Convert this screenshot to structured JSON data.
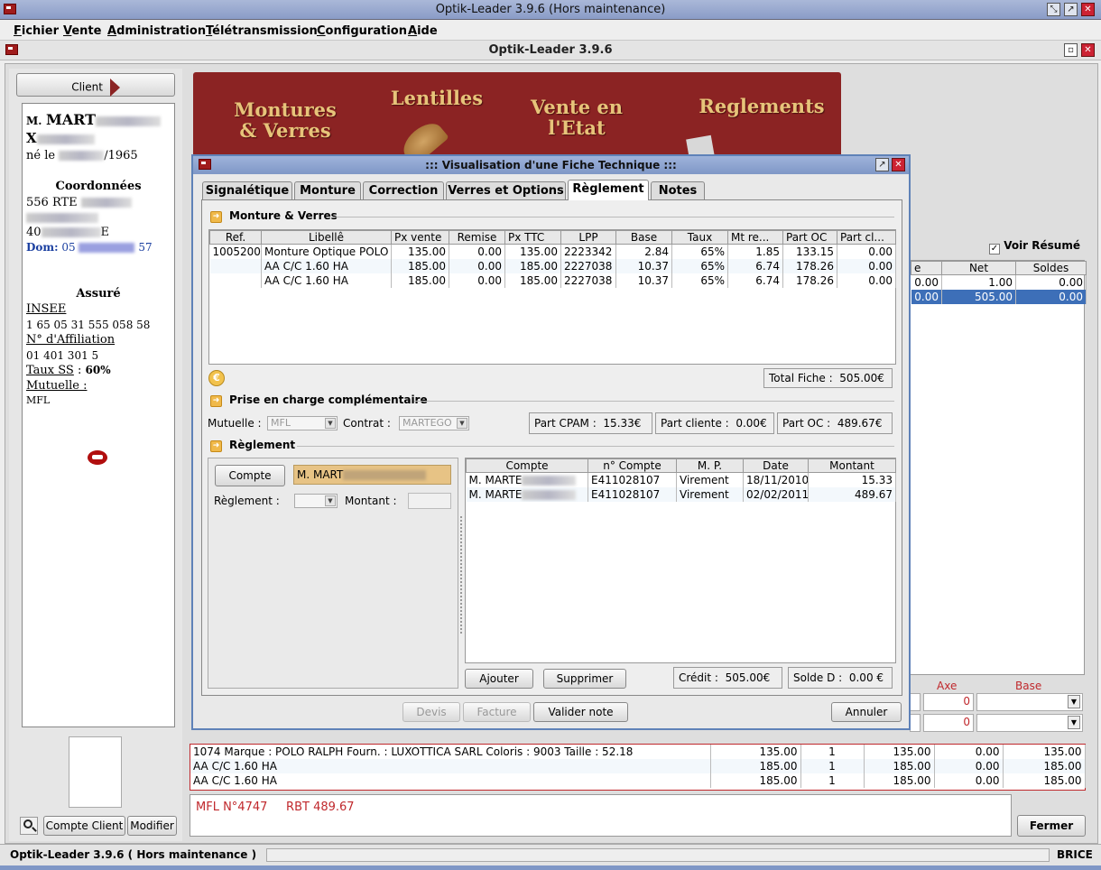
{
  "window": {
    "title": "Optik-Leader 3.9.6 (Hors maintenance)",
    "inner_title": "Optik-Leader 3.9.6"
  },
  "menu": [
    "Fichier",
    "Vente",
    "Administration",
    "Télétransmission",
    "Configuration",
    "Aide"
  ],
  "client_panel": {
    "client_button": "Client",
    "name_prefix": "M.",
    "name": "MART",
    "first_name": "X",
    "born": "né le",
    "born_year": "/1965",
    "coord_title": "Coordonnées",
    "address1": "556 RTE",
    "address3": "40",
    "address3_end": "E",
    "dom_label": "Dom:",
    "dom_prefix": "05",
    "dom_suffix": "57",
    "assure_title": "Assuré",
    "insee_label": "INSEE",
    "insee": "1 65 05 31 555 058 58",
    "affiliation_label": "N° d'Affiliation",
    "affiliation": "01 401 301 5",
    "taux_label": "Taux SS",
    "taux": "60%",
    "mutuelle_label": "Mutuelle :",
    "mutuelle": "MFL",
    "btn_compte": "Compte Client",
    "btn_modifier": "Modifier"
  },
  "banner": {
    "montures_1": "Montures",
    "montures_2": "& Verres",
    "lentilles": "Lentilles",
    "vente_1": "Vente en",
    "vente_2": "l'Etat",
    "reglements": "Reglements"
  },
  "right_panel": {
    "voir_resume": "Voir Résumé",
    "headers": [
      "e",
      "Net",
      "Soldes"
    ],
    "rows": [
      [
        "0.00",
        "1.00",
        "0.00"
      ],
      [
        "0.00",
        "505.00",
        "0.00"
      ]
    ],
    "axe_label": "Axe",
    "base_label": "Base",
    "axe_values": [
      "0",
      "0"
    ]
  },
  "dialog": {
    "title": "::: Visualisation d'une Fiche Technique :::",
    "tabs": [
      "Signalétique",
      "Monture",
      "Correction",
      "Verres et Options",
      "Règlement",
      "Notes"
    ],
    "sect_monture": "Monture & Verres",
    "table_headers": [
      "Ref.",
      "Libellê",
      "Px vente",
      "Remise",
      "Px TTC",
      "LPP",
      "Base",
      "Taux",
      "Mt re...",
      "Part OC",
      "Part cl..."
    ],
    "table_rows": [
      [
        "1005200",
        "Monture Optique POLO R",
        "135.00",
        "0.00",
        "135.00",
        "2223342",
        "2.84",
        "65%",
        "1.85",
        "133.15",
        "0.00"
      ],
      [
        "",
        "AA C/C 1.60 HA",
        "185.00",
        "0.00",
        "185.00",
        "2227038",
        "10.37",
        "65%",
        "6.74",
        "178.26",
        "0.00"
      ],
      [
        "",
        "AA C/C 1.60 HA",
        "185.00",
        "0.00",
        "185.00",
        "2227038",
        "10.37",
        "65%",
        "6.74",
        "178.26",
        "0.00"
      ]
    ],
    "total_fiche_label": "Total Fiche :",
    "total_fiche": "505.00€",
    "sect_prise": "Prise en charge complémentaire",
    "mutuelle_label": "Mutuelle :",
    "mutuelle_value": "MFL",
    "contrat_label": "Contrat :",
    "contrat_value": "MARTEGO",
    "part_cpam_label": "Part CPAM :",
    "part_cpam": "15.33€",
    "part_cliente_label": "Part cliente :",
    "part_cliente": "0.00€",
    "part_oc_label": "Part OC :",
    "part_oc": "489.67€",
    "sect_reglement": "Règlement",
    "compte_button": "Compte",
    "compte_value": "M. MART",
    "reglement_label": "Règlement :",
    "montant_label": "Montant :",
    "pay_headers": [
      "Compte",
      "n° Compte",
      "M. P.",
      "Date",
      "Montant"
    ],
    "pay_rows": [
      [
        "M. MARTE",
        "E411028107",
        "Virement",
        "18/11/2010",
        "15.33"
      ],
      [
        "M. MARTE",
        "E411028107",
        "Virement",
        "02/02/2011",
        "489.67"
      ]
    ],
    "ajouter": "Ajouter",
    "supprimer": "Supprimer",
    "credit_label": "Crédit :",
    "credit": "505.00€",
    "solde_label": "Solde D :",
    "solde": "0.00 €",
    "devis": "Devis",
    "facture": "Facture",
    "valider": "Valider note",
    "annuler": "Annuler"
  },
  "bottom_table": [
    [
      "1074   Marque : POLO RALPH   Fourn. : LUXOTTICA SARL   Coloris : 9003   Taille : 52.18",
      "135.00",
      "1",
      "135.00",
      "0.00",
      "135.00"
    ],
    [
      "AA C/C 1.60 HA",
      "185.00",
      "1",
      "185.00",
      "0.00",
      "185.00"
    ],
    [
      "AA C/C 1.60 HA",
      "185.00",
      "1",
      "185.00",
      "0.00",
      "185.00"
    ]
  ],
  "note": "MFL N°4747     RBT 489.67",
  "fermer": "Fermer",
  "status": {
    "left": "Optik-Leader 3.9.6 ( Hors maintenance )",
    "user": "BRICE"
  },
  "colors": {
    "banner": "#8b2323",
    "banner_text": "#e7c47a",
    "selection": "#3d6fb8",
    "note_text": "#c0282c"
  }
}
